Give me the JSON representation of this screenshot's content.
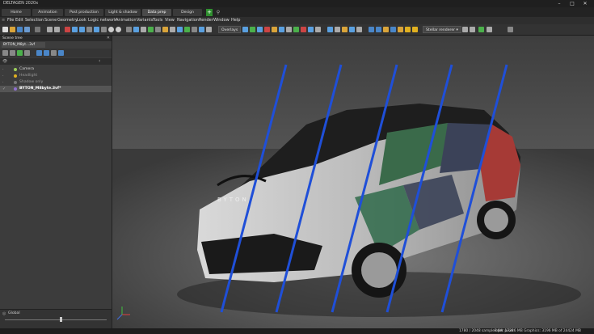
{
  "window": {
    "title": "DELTAGEN 2020x"
  },
  "tabs": [
    {
      "label": "Home"
    },
    {
      "label": "Animation"
    },
    {
      "label": "Post production"
    },
    {
      "label": "Light & shadow"
    },
    {
      "label": "Data prep"
    },
    {
      "label": "Design"
    }
  ],
  "menu": [
    "File",
    "Edit",
    "Selection",
    "Scene",
    "Geometry",
    "Look",
    "Logic network",
    "Animation",
    "Variants",
    "Tools",
    "View",
    "Navigation",
    "Render",
    "Window",
    "Help"
  ],
  "toolbar": {
    "overlays_label": "Overlays",
    "renderer_label": "Stellar renderer"
  },
  "scene_tree": {
    "panel_title": "Scene tree",
    "file_tab": "BYTON_M8yt...3vf",
    "items": [
      {
        "label": "Camera"
      },
      {
        "label": "Headlight"
      },
      {
        "label": "Shadow only"
      },
      {
        "label": "BYTON_M8byte.3vf*"
      }
    ]
  },
  "bottom_panel": {
    "label": "Global",
    "slider_value": 0.55
  },
  "status": {
    "samples": "1780 / 2048 samples per pixel",
    "memory": "RAM: 17286 MB Graphics: 3196 MB of 24424 MB"
  },
  "viewport": {
    "badge_text": "BYTON",
    "stripe_color": "#1f4fd8"
  },
  "colors": {
    "accent": "#2f8f2f",
    "panel": "#3c3c3c",
    "viewport": "#4f4f4f"
  }
}
